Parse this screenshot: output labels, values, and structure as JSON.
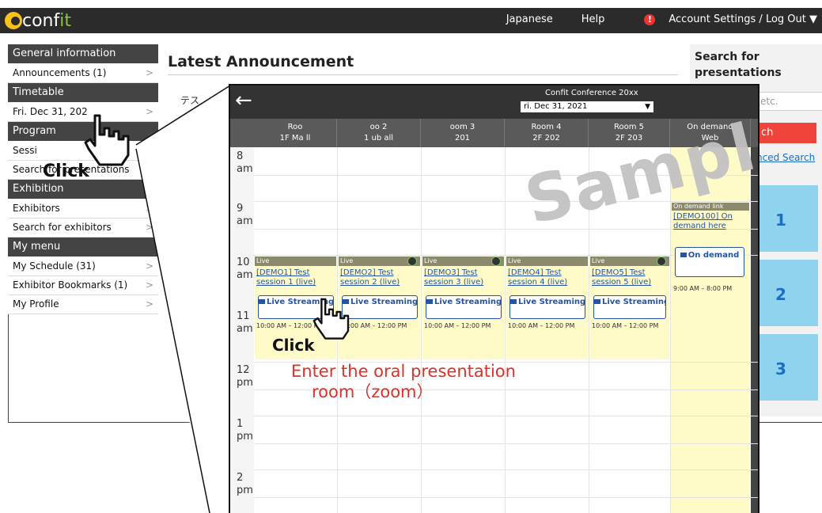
{
  "brand": {
    "prefix": "conf",
    "accent": "it"
  },
  "topnav": {
    "language": "Japanese",
    "help": "Help",
    "account": "Account Settings / Log Out ▼"
  },
  "sidebar": {
    "general_head": "General information",
    "announcements": "Announcements (1)",
    "timetable_head": "Timetable",
    "date_item": "Fri. Dec 31, 202",
    "program_head": "Program",
    "sessions": "Sessi",
    "search_presentations": "Search for presentations",
    "exhibition_head": "Exhibition",
    "exhibitors": "Exhibitors",
    "search_exhibitors": "Search for exhibitors",
    "mymenu_head": "My menu",
    "my_schedule": "My Schedule (31)",
    "exhibitor_bookmarks": "Exhibitor Bookmarks (1)",
    "my_profile": "My Profile",
    "chevron": ">"
  },
  "main": {
    "title": "Latest Announcement",
    "sub": "テス"
  },
  "search_panel": {
    "title": "Search for presentations",
    "input_fragment": "etc.",
    "button_fragment": "ch",
    "advanced_link": "nced Search",
    "room_numbers": [
      "1",
      "2",
      "3"
    ]
  },
  "overlay": {
    "back": "←",
    "conference": "Confit Conference 20xx",
    "date": "ri. Dec 31, 2021",
    "dropdown": "▼",
    "columns": [
      {
        "name": "Roo",
        "sub": "1F Ma  ll"
      },
      {
        "name": "oo  2",
        "sub": "1  ub  all"
      },
      {
        "name": "oom 3",
        "sub": "201"
      },
      {
        "name": "Room 4",
        "sub": "2F 202"
      },
      {
        "name": "Room 5",
        "sub": "2F 203"
      },
      {
        "name": "On demand",
        "sub": "Web"
      }
    ],
    "times": [
      {
        "h": "8",
        "p": "am"
      },
      {
        "h": "9",
        "p": "am"
      },
      {
        "h": "10",
        "p": "am"
      },
      {
        "h": "11",
        "p": "am"
      },
      {
        "h": "12",
        "p": "pm"
      },
      {
        "h": "1",
        "p": "pm"
      },
      {
        "h": "2",
        "p": "pm"
      }
    ],
    "sessions": [
      {
        "tag": "Live",
        "title": "[DEMO1] Test session 1 (live)",
        "btn": "Live Streaming (Zoom",
        "time": "10:00 AM – 12:00 PM"
      },
      {
        "tag": "Live",
        "title": "[DEMO2] Test session 2 (live)",
        "btn": "Live Streaming (Zoom",
        "time": "10:00 AM – 12:00 PM"
      },
      {
        "tag": "Live",
        "title": "[DEMO3] Test session 3 (live)",
        "btn": "Live Streaming (Zoom",
        "time": "10:00 AM – 12:00 PM"
      },
      {
        "tag": "Live",
        "title": "[DEMO4] Test session 4 (live)",
        "btn": "Live Streaming (Zoom",
        "time": "10:00 AM – 12:00 PM"
      },
      {
        "tag": "Live",
        "title": "[DEMO5] Test session 5 (live)",
        "btn": "Live Streaming (Zoom",
        "time": "10:00 AM – 12:00 PM"
      }
    ],
    "ondemand": {
      "tag": "On demand link",
      "title": "[DEMO100] On demand here",
      "btn": "On demand",
      "time": "9:00 AM – 8:00 PM"
    }
  },
  "watermark": "Sample",
  "click_label": "Click",
  "annotation": {
    "line1": "Enter the oral presentation",
    "line2": "room（zoom）"
  },
  "colors": {
    "topbar": "#2b2b2b",
    "sidebar_head": "#444444",
    "session_bg": "#fffbc8",
    "link": "#2554a6",
    "search_btn": "#f0433a",
    "room_box": "#8fd3ee",
    "annotation": "#e0302a"
  }
}
